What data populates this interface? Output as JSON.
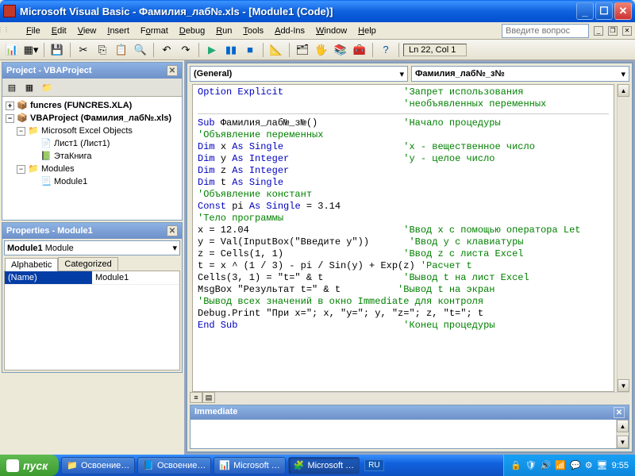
{
  "window": {
    "title": "Microsoft Visual Basic - Фамилия_лаб№.xls - [Module1 (Code)]"
  },
  "menu": {
    "file": "File",
    "edit": "Edit",
    "view": "View",
    "insert": "Insert",
    "format": "Format",
    "debug": "Debug",
    "run": "Run",
    "tools": "Tools",
    "addins": "Add-Ins",
    "window": "Window",
    "help": "Help",
    "question_placeholder": "Введите вопрос"
  },
  "toolbar": {
    "position": "Ln 22, Col 1"
  },
  "project_panel": {
    "title": "Project - VBAProject",
    "nodes": {
      "funcres": "funcres (FUNCRES.XLA)",
      "vbaproject": "VBAProject (Фамилия_лаб№.xls)",
      "excel_objects": "Microsoft Excel Objects",
      "sheet1": "Лист1 (Лист1)",
      "thisworkbook": "ЭтаКнига",
      "modules": "Modules",
      "module1": "Module1"
    }
  },
  "properties_panel": {
    "title": "Properties - Module1",
    "object": "Module1",
    "object_type": "Module",
    "tabs": {
      "alphabetic": "Alphabetic",
      "categorized": "Categorized"
    },
    "rows": {
      "name_key": "(Name)",
      "name_val": "Module1"
    }
  },
  "code_selects": {
    "left": "(General)",
    "right": "Фамилия_лаб№_з№"
  },
  "code": {
    "l1a": "Option Explicit",
    "l1b": "'Запрет использования",
    "l1c": "'необъявленных переменных",
    "l3a": "Sub ",
    "l3b": "Фамилия_лаб№_з№()",
    "l3c": "'Начало процедуры",
    "l4": "'Объявление переменных",
    "l5a": "Dim ",
    "l5b": "x ",
    "l5c": "As Single",
    "l5d": "'x - вещественное число",
    "l6a": "Dim ",
    "l6b": "y ",
    "l6c": "As Integer",
    "l6d": "'y - целое число",
    "l7a": "Dim ",
    "l7b": "z ",
    "l7c": "As Integer",
    "l8a": "Dim ",
    "l8b": "t ",
    "l8c": "As Single",
    "l9": "'Объявление констант",
    "l10a": "Const ",
    "l10b": "pi ",
    "l10c": "As Single ",
    "l10d": "= 3.14",
    "l11": "'Тело программы",
    "l12a": "x = 12.04",
    "l12b": "'Ввод x с помощью оператора Let",
    "l13a": "y = Val(InputBox(\"Введите y\"))",
    "l13b": "'Ввод y с клавиатуры",
    "l14a": "z = Cells(1, 1)",
    "l14b": "'Ввод z с листа Excel",
    "l15a": "t = x ^ (1 / 3) - pi / Sin(y) + Exp(z) ",
    "l15b": "'Расчет t",
    "l16a": "Cells(3, 1) = \"t=\" & t",
    "l16b": "'Вывод t на лист Excel",
    "l17a": "MsgBox \"Результат t=\" & t",
    "l17b": "'Вывод t на экран",
    "l18": "'Вывод всех значений в окно Immediate для контроля",
    "l19": "Debug.Print \"При x=\"; x, \"y=\"; y, \"z=\"; z, \"t=\"; t",
    "l20a": "End Sub",
    "l20b": "'Конец процедуры"
  },
  "immediate": {
    "title": "Immediate"
  },
  "taskbar": {
    "start": "пуск",
    "btn1": "Освоение…",
    "btn2": "Освоение…",
    "btn3": "Microsoft …",
    "btn4": "Microsoft …",
    "lang": "RU",
    "time": "9:55"
  }
}
